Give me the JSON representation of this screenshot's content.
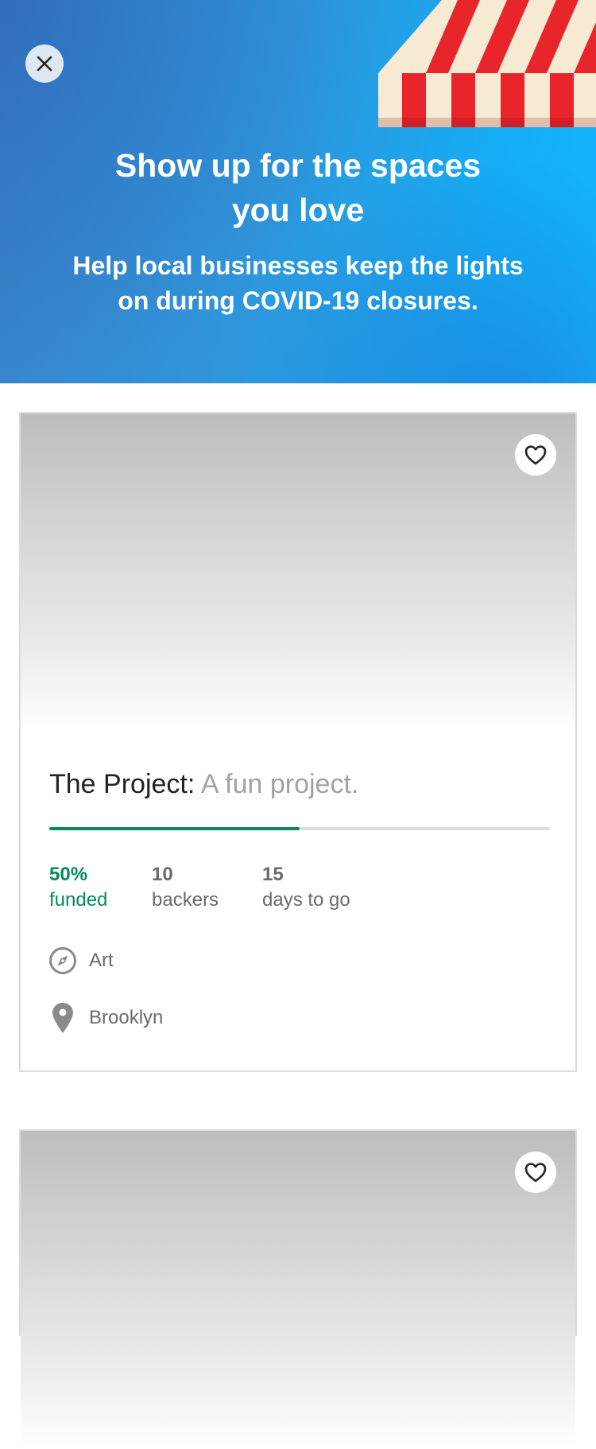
{
  "header": {
    "title": "Show up for the spaces you love",
    "subtitle": "Help local businesses keep the lights on during COVID-19 closures.",
    "close_icon": "close-icon",
    "background_color": "#2f96db",
    "awning_colors": [
      "#e8252b",
      "#f6ead2"
    ]
  },
  "projects": [
    {
      "name": "The Project:",
      "blurb": "A fun project.",
      "percent_funded": 50,
      "percent_value": "50%",
      "funded_label": "funded",
      "backers_value": "10",
      "backers_label": "backers",
      "days_value": "15",
      "days_label": "days to go",
      "category": "Art",
      "category_icon": "compass-icon",
      "location": "Brooklyn",
      "location_icon": "location-pin-icon",
      "favorite_icon": "heart-icon"
    },
    {
      "favorite_icon": "heart-icon"
    }
  ],
  "colors": {
    "funded_green": "#058a5d",
    "progress_track": "#dcdde2",
    "muted_text": "#6a6a6a"
  }
}
